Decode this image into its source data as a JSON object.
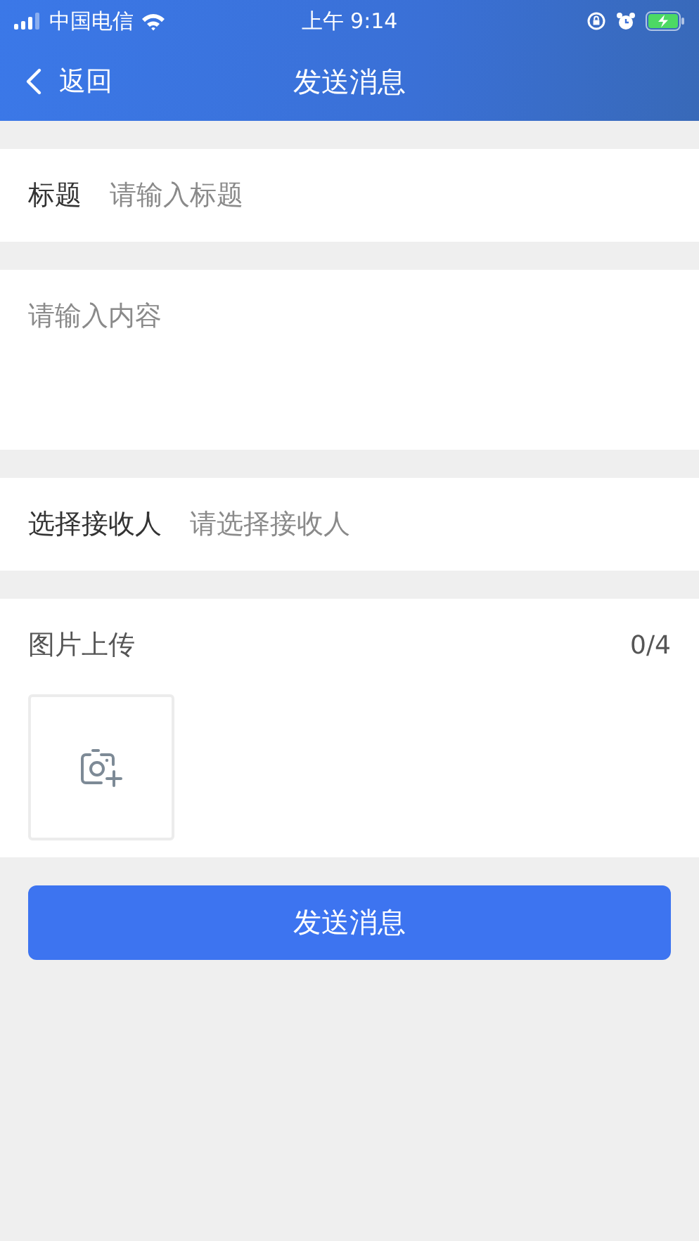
{
  "status_bar": {
    "carrier": "中国电信",
    "time": "上午 9:14"
  },
  "nav": {
    "back_label": "返回",
    "title": "发送消息"
  },
  "title_field": {
    "label": "标题",
    "placeholder": "请输入标题"
  },
  "content_field": {
    "placeholder": "请输入内容"
  },
  "receiver_field": {
    "label": "选择接收人",
    "placeholder": "请选择接收人"
  },
  "upload": {
    "label": "图片上传",
    "count": "0/4"
  },
  "submit_button": "发送消息"
}
